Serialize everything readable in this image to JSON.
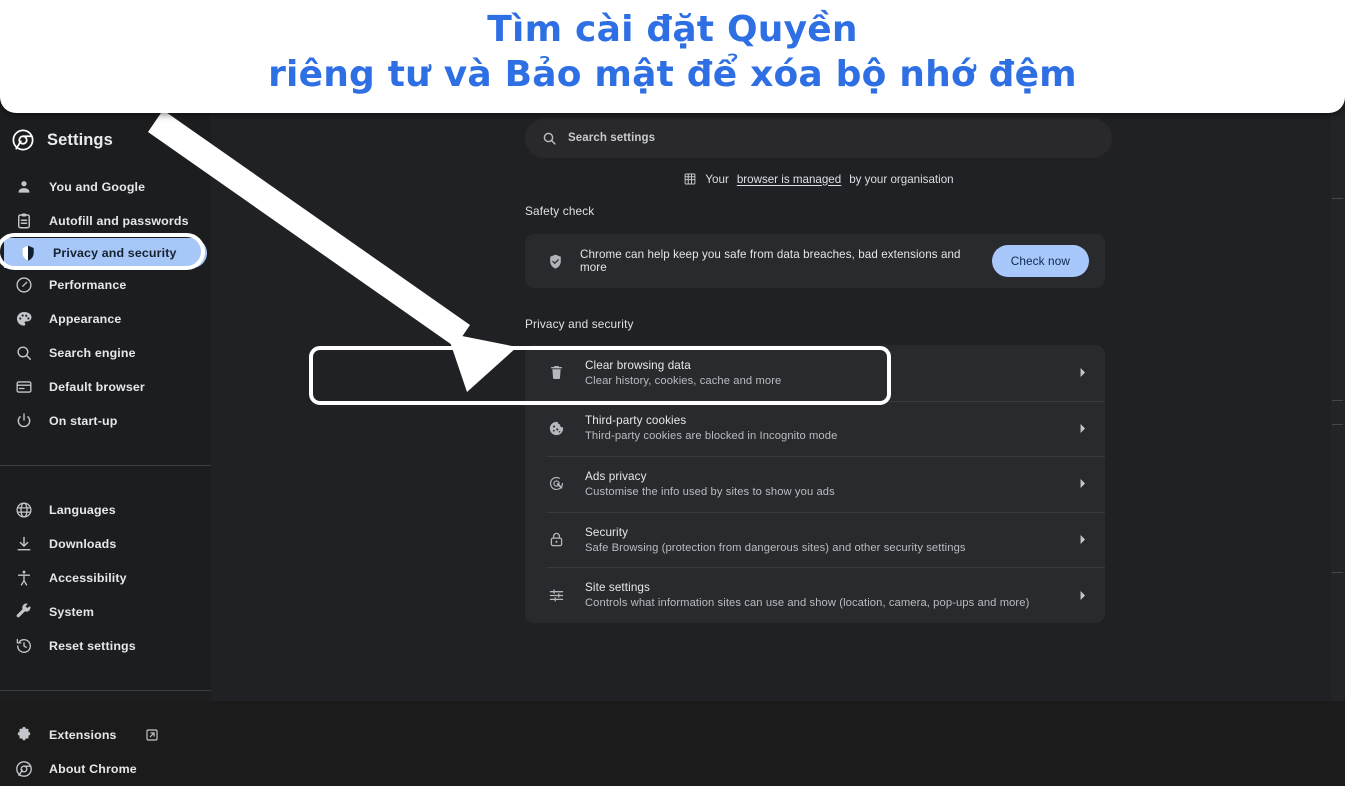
{
  "banner": {
    "line1": "Tìm cài đặt Quyền",
    "line2": "riêng tư và Bảo mật để xóa bộ nhớ đệm",
    "color": "#2f6fe4",
    "background": "#ffffff"
  },
  "annotation": {
    "arrow_color": "#ffffff",
    "highlight_color": "#ffffff",
    "targets": [
      "Privacy and security",
      "Clear browsing data"
    ]
  },
  "sidebar": {
    "brand": "Settings",
    "brand_icon": "chrome-logo-icon",
    "selected_item": "Privacy and security",
    "selected_background": "#a7c7f8",
    "groups": [
      {
        "items": [
          {
            "label": "You and Google",
            "icon": "person-icon"
          },
          {
            "label": "Autofill and passwords",
            "icon": "clipboard-icon"
          },
          {
            "label": "Privacy and security",
            "icon": "shield-icon",
            "selected": true
          },
          {
            "label": "Performance",
            "icon": "speedometer-icon"
          },
          {
            "label": "Appearance",
            "icon": "palette-icon"
          },
          {
            "label": "Search engine",
            "icon": "magnifier-icon"
          },
          {
            "label": "Default browser",
            "icon": "window-icon"
          },
          {
            "label": "On start-up",
            "icon": "power-icon"
          }
        ]
      },
      {
        "items": [
          {
            "label": "Languages",
            "icon": "globe-icon"
          },
          {
            "label": "Downloads",
            "icon": "download-icon"
          },
          {
            "label": "Accessibility",
            "icon": "accessibility-icon"
          },
          {
            "label": "System",
            "icon": "wrench-icon"
          },
          {
            "label": "Reset settings",
            "icon": "history-icon"
          }
        ]
      },
      {
        "items": [
          {
            "label": "Extensions",
            "icon": "puzzle-icon",
            "external": true,
            "external_icon": "external-link-icon"
          },
          {
            "label": "About Chrome",
            "icon": "chrome-logo-icon"
          }
        ]
      }
    ]
  },
  "search": {
    "placeholder": "Search settings",
    "icon": "search-icon",
    "value": ""
  },
  "managed_notice": {
    "icon": "enterprise-building-icon",
    "prefix": "Your ",
    "link": "browser is managed",
    "suffix": " by your organisation"
  },
  "safety_check": {
    "section_title": "Safety check",
    "icon": "shield-check-icon",
    "description": "Chrome can help keep you safe from data breaches, bad extensions and more",
    "button_label": "Check now",
    "button_color": "#a8c7fa"
  },
  "privacy": {
    "section_title": "Privacy and security",
    "rows": [
      {
        "title": "Clear browsing data",
        "subtitle": "Clear history, cookies, cache and more",
        "icon": "trash-icon",
        "chevron": "chevron-right-icon",
        "highlighted": true
      },
      {
        "title": "Third-party cookies",
        "subtitle": "Third-party cookies are blocked in Incognito mode",
        "icon": "cookie-icon",
        "chevron": "chevron-right-icon"
      },
      {
        "title": "Ads privacy",
        "subtitle": "Customise the info used by sites to show you ads",
        "icon": "ads-privacy-icon",
        "chevron": "chevron-right-icon"
      },
      {
        "title": "Security",
        "subtitle": "Safe Browsing (protection from dangerous sites) and other security settings",
        "icon": "lock-icon",
        "chevron": "chevron-right-icon"
      },
      {
        "title": "Site settings",
        "subtitle": "Controls what information sites can use and show (location, camera, pop-ups and more)",
        "icon": "sliders-icon",
        "chevron": "chevron-right-icon"
      }
    ]
  }
}
